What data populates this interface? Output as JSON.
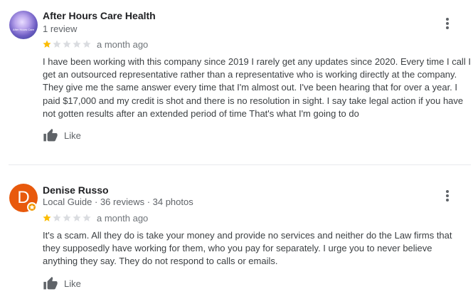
{
  "reviews": [
    {
      "reviewer_name": "After Hours Care Health",
      "reviewer_meta": "1 review",
      "avatar_text": "After Hours Care",
      "rating": 1,
      "max_rating": 5,
      "date": "a month ago",
      "text_lines": [
        "I have been working with this company since 2019 I rarely get any updates since 2020. Every time I call I",
        "get an outsourced representative rather than a representative who is working directly at the company.",
        "They give me the same answer every time that I'm almost out. I've been hearing that for over a year. I",
        "paid $17,000 and my credit is shot and there is no resolution in sight. I say take legal action if you have",
        "not gotten results after an extended period of time That's what I'm going to do"
      ],
      "like_label": "Like"
    },
    {
      "reviewer_name": "Denise Russo",
      "avatar_letter": "D",
      "local_guide_label": "Local Guide",
      "reviewer_meta": " · 36 reviews · 34 photos",
      "rating": 1,
      "max_rating": 5,
      "date": "a month ago",
      "text_lines": [
        "It's a scam. All they do is take your money and provide no services and neither do the Law firms that",
        "they supposedly have working for them, who you pay for separately.  I urge you to never believe",
        "anything they say. They do not respond to calls or emails."
      ],
      "like_label": "Like"
    }
  ],
  "icons": {
    "menu": "more-vert-icon",
    "like": "thumb-up-icon",
    "star": "star-icon",
    "guide": "local-guide-badge-icon"
  },
  "colors": {
    "star_filled": "#fbbc04",
    "star_empty": "#dadce0",
    "avatar_d": "#e8590c",
    "guide_badge": "#f29900"
  }
}
